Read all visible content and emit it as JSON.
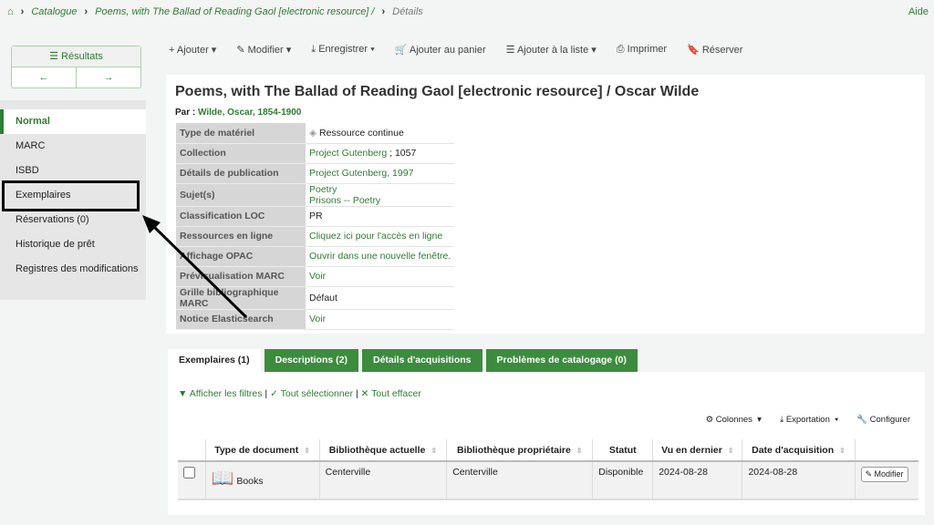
{
  "breadcrumb": {
    "home": "home-icon",
    "items": [
      "Catalogue",
      "Poems, with The Ballad of Reading Gaol [electronic resource] /"
    ],
    "current": "Détails"
  },
  "help": "Aide",
  "results": {
    "label": "Résultats",
    "prev": "←",
    "next": "→"
  },
  "sidebar": {
    "items": [
      {
        "label": "Normal",
        "active": true
      },
      {
        "label": "MARC"
      },
      {
        "label": "ISBD"
      },
      {
        "label": "Exemplaires",
        "highlighted": true
      },
      {
        "label": "Réservations (0)"
      },
      {
        "label": "Historique de prêt"
      },
      {
        "label": "Registres des modifications"
      }
    ]
  },
  "toolbar": {
    "add": "Ajouter",
    "edit": "Modifier",
    "save": "Enregistrer",
    "cart": "Ajouter au panier",
    "list": "Ajouter à la liste",
    "print": "Imprimer",
    "hold": "Réserver"
  },
  "record": {
    "title": "Poems, with The Ballad of Reading Gaol [electronic resource] / Oscar Wilde",
    "by_label": "Par :",
    "author": "Wilde, Oscar, 1854-1900",
    "fields": [
      {
        "label": "Type de matériel",
        "value": "Ressource continue"
      },
      {
        "label": "Collection",
        "value": "Project Gutenberg",
        "extra": " ; 1057"
      },
      {
        "label": "Détails de publication",
        "value": "Project Gutenberg, 1997"
      },
      {
        "label": "Sujet(s)",
        "value": "Poetry",
        "value2": "Prisons -- Poetry"
      },
      {
        "label": "Classification LOC",
        "value": "PR"
      },
      {
        "label": "Ressources en ligne",
        "value": "Cliquez ici pour l'accès en ligne"
      },
      {
        "label": "Affichage OPAC",
        "value": "Ouvrir dans une nouvelle fenêtre."
      },
      {
        "label": "Prévisualisation MARC",
        "value": "Voir"
      },
      {
        "label": "Grille bibliographique MARC",
        "value": "Défaut"
      },
      {
        "label": "Notice Elasticsearch",
        "value": "Voir"
      }
    ]
  },
  "tabs": [
    "Exemplaires (1)",
    "Descriptions (2)",
    "Détails d'acquisitions",
    "Problèmes de catalogage (0)"
  ],
  "filters": {
    "show": "Afficher les filtres",
    "select_all": "Tout sélectionner",
    "clear": "Tout effacer",
    "sep": "|"
  },
  "table_tools": {
    "columns": "Colonnes",
    "export": "Exportation",
    "configure": "Configurer"
  },
  "items_table": {
    "headers": [
      "Type de document",
      "Bibliothèque actuelle",
      "Bibliothèque propriétaire",
      "Statut",
      "Vu en dernier",
      "Date d'acquisition"
    ],
    "rows": [
      {
        "type": "Books",
        "current": "Centerville",
        "home": "Centerville",
        "status": "Disponible",
        "last_seen": "2024-08-28",
        "acquired": "2024-08-28",
        "action": "Modifier"
      }
    ]
  },
  "colors": {
    "accent": "#2e7d32",
    "tab": "#3c8c3e"
  }
}
